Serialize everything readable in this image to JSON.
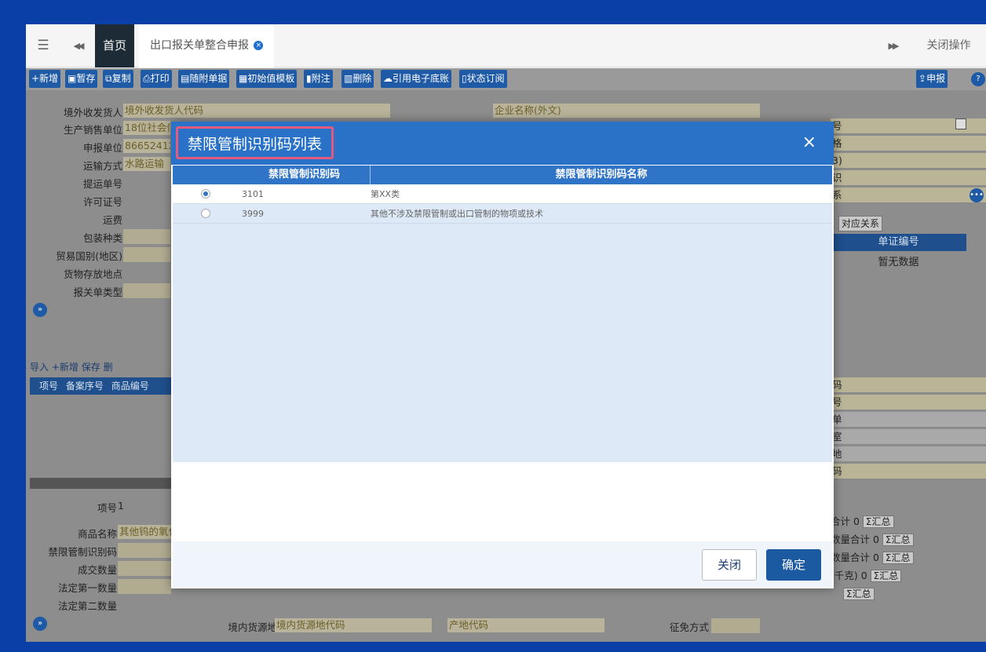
{
  "tabbar": {
    "menu_icon": "☰",
    "prev_icon": "◀◀",
    "home_tab": "首页",
    "active_tab": "出口报关单整合申报",
    "next_icon": "▶▶",
    "close_ops": "关闭操作"
  },
  "toolbar": {
    "items": [
      "+新增",
      "暂存",
      "复制",
      "打印",
      "随附单据",
      "初始值模板",
      "附注",
      "删除",
      "引用电子底账",
      "状态订阅"
    ],
    "declare": "申报",
    "help": "?"
  },
  "form": {
    "labels": [
      "境外收发货人",
      "生产销售单位",
      "申报单位",
      "运输方式",
      "提运单号",
      "许可证号",
      "运费",
      "包装种类",
      "贸易国别(地区)",
      "货物存放地点",
      "报关单类型"
    ],
    "values": [
      "境外收发货人代码",
      "18位社会信用",
      "86652412",
      "水路运输",
      "",
      "",
      "",
      "",
      "",
      "",
      ""
    ],
    "foreign_name_placeholder": "企业名称(外文)"
  },
  "goods": {
    "tools": [
      "导入",
      "+新增",
      "保存",
      "删"
    ],
    "columns": [
      "项号",
      "备案序号",
      "商品编号"
    ],
    "labels": [
      "项号",
      "商品名称",
      "禁限管制识别码",
      "成交数量",
      "法定第一数量",
      "法定第二数量"
    ],
    "item_no": "1",
    "goods_name": "其他钨的氧化",
    "origin_label": "境内货源地",
    "origin_placeholder": "境内货源地代码",
    "origin_code_placeholder": "产地代码",
    "levy_label": "征免方式"
  },
  "right_panel": {
    "rows": [
      "号",
      "格",
      "3)",
      "识",
      "系"
    ],
    "relation_btn": "对应关系",
    "doc_no_header": "单证编号",
    "no_data": "暂无数据",
    "lower_rows": [
      "码",
      "号",
      "单",
      "室",
      "地",
      "码"
    ],
    "totals": [
      "合计 0",
      "数量合计 0",
      "数量合计 0",
      "(千克) 0",
      ""
    ],
    "sum_btn": "Σ汇总"
  },
  "modal": {
    "title": "禁限管制识别码列表",
    "close_icon": "×",
    "columns": [
      "禁限管制识别码",
      "禁限管制识别码名称"
    ],
    "rows": [
      {
        "code": "3101",
        "name": "第XX类",
        "checked": true
      },
      {
        "code": "3999",
        "name": "其他不涉及禁限管制或出口管制的物项或技术",
        "checked": false
      }
    ],
    "close_btn": "关闭",
    "ok_btn": "确定"
  }
}
